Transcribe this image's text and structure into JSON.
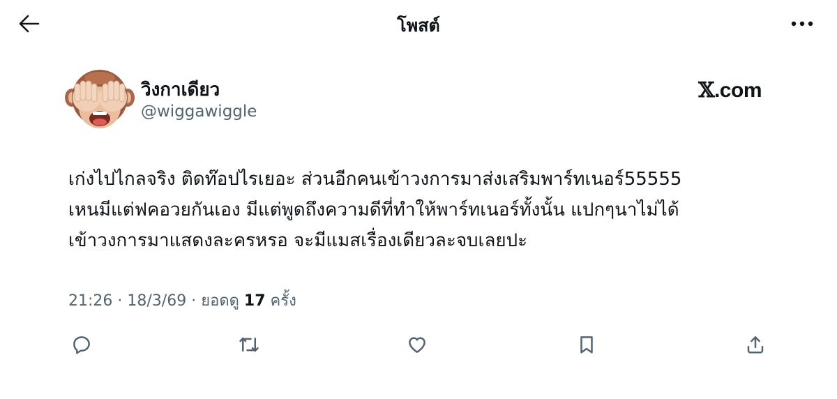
{
  "header": {
    "title": "โพสต์",
    "back_icon": "arrow-left-icon",
    "more_icon": "more-horizontal-icon"
  },
  "author": {
    "display_name": "วิงกาเดียว",
    "handle": "@wiggawiggle",
    "avatar": "see-no-evil-monkey-emoji"
  },
  "brand": {
    "x_glyph": "𝕏",
    "domain": ".com"
  },
  "tweet": {
    "lines": [
      "เก่งไปไกลจริง ติดท๊อปไรเยอะ ส่วนอีกคนเข้าวงการมาส่งเสริมพาร์ทเนอร์55555",
      "เหนมีแต่ฟคอวยกันเอง มีแต่พูดถึงความดีที่ทำให้พาร์ทเนอร์ทั้งนั้น แปกๆนาไม่ได้",
      "เข้าวงการมาแสดงละครหรอ จะมีแมสเรื่องเดียวละจบเลยปะ"
    ]
  },
  "meta": {
    "time": "21:26",
    "separator": "·",
    "date": "18/3/69",
    "views_label": "ยอดดู",
    "views_count": "17",
    "views_unit": "ครั้ง"
  },
  "actions": [
    {
      "name": "reply",
      "icon": "reply-icon"
    },
    {
      "name": "repost",
      "icon": "repost-icon"
    },
    {
      "name": "like",
      "icon": "heart-icon"
    },
    {
      "name": "bookmark",
      "icon": "bookmark-icon"
    },
    {
      "name": "share",
      "icon": "share-icon"
    }
  ],
  "colors": {
    "text": "#0f1419",
    "secondary": "#536471",
    "background": "#ffffff"
  }
}
